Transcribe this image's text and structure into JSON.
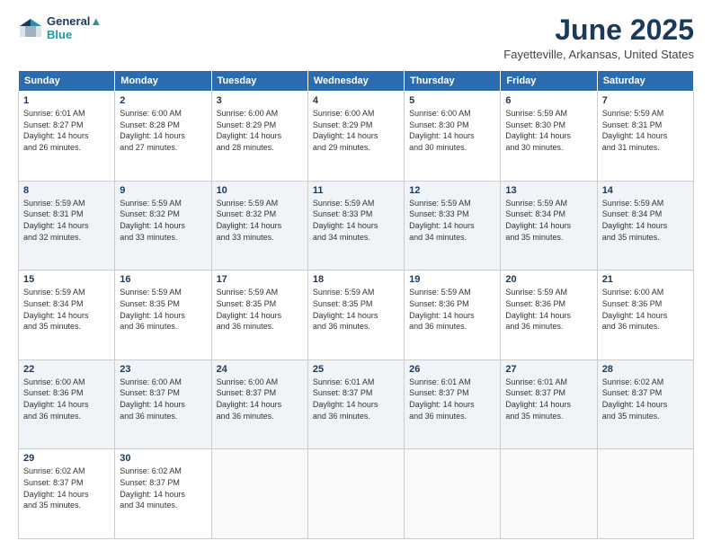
{
  "header": {
    "logo_line1": "General",
    "logo_line2": "Blue",
    "month_title": "June 2025",
    "location": "Fayetteville, Arkansas, United States"
  },
  "days_of_week": [
    "Sunday",
    "Monday",
    "Tuesday",
    "Wednesday",
    "Thursday",
    "Friday",
    "Saturday"
  ],
  "weeks": [
    [
      {
        "day": "1",
        "info": "Sunrise: 6:01 AM\nSunset: 8:27 PM\nDaylight: 14 hours\nand 26 minutes."
      },
      {
        "day": "2",
        "info": "Sunrise: 6:00 AM\nSunset: 8:28 PM\nDaylight: 14 hours\nand 27 minutes."
      },
      {
        "day": "3",
        "info": "Sunrise: 6:00 AM\nSunset: 8:29 PM\nDaylight: 14 hours\nand 28 minutes."
      },
      {
        "day": "4",
        "info": "Sunrise: 6:00 AM\nSunset: 8:29 PM\nDaylight: 14 hours\nand 29 minutes."
      },
      {
        "day": "5",
        "info": "Sunrise: 6:00 AM\nSunset: 8:30 PM\nDaylight: 14 hours\nand 30 minutes."
      },
      {
        "day": "6",
        "info": "Sunrise: 5:59 AM\nSunset: 8:30 PM\nDaylight: 14 hours\nand 30 minutes."
      },
      {
        "day": "7",
        "info": "Sunrise: 5:59 AM\nSunset: 8:31 PM\nDaylight: 14 hours\nand 31 minutes."
      }
    ],
    [
      {
        "day": "8",
        "info": "Sunrise: 5:59 AM\nSunset: 8:31 PM\nDaylight: 14 hours\nand 32 minutes."
      },
      {
        "day": "9",
        "info": "Sunrise: 5:59 AM\nSunset: 8:32 PM\nDaylight: 14 hours\nand 33 minutes."
      },
      {
        "day": "10",
        "info": "Sunrise: 5:59 AM\nSunset: 8:32 PM\nDaylight: 14 hours\nand 33 minutes."
      },
      {
        "day": "11",
        "info": "Sunrise: 5:59 AM\nSunset: 8:33 PM\nDaylight: 14 hours\nand 34 minutes."
      },
      {
        "day": "12",
        "info": "Sunrise: 5:59 AM\nSunset: 8:33 PM\nDaylight: 14 hours\nand 34 minutes."
      },
      {
        "day": "13",
        "info": "Sunrise: 5:59 AM\nSunset: 8:34 PM\nDaylight: 14 hours\nand 35 minutes."
      },
      {
        "day": "14",
        "info": "Sunrise: 5:59 AM\nSunset: 8:34 PM\nDaylight: 14 hours\nand 35 minutes."
      }
    ],
    [
      {
        "day": "15",
        "info": "Sunrise: 5:59 AM\nSunset: 8:34 PM\nDaylight: 14 hours\nand 35 minutes."
      },
      {
        "day": "16",
        "info": "Sunrise: 5:59 AM\nSunset: 8:35 PM\nDaylight: 14 hours\nand 36 minutes."
      },
      {
        "day": "17",
        "info": "Sunrise: 5:59 AM\nSunset: 8:35 PM\nDaylight: 14 hours\nand 36 minutes."
      },
      {
        "day": "18",
        "info": "Sunrise: 5:59 AM\nSunset: 8:35 PM\nDaylight: 14 hours\nand 36 minutes."
      },
      {
        "day": "19",
        "info": "Sunrise: 5:59 AM\nSunset: 8:36 PM\nDaylight: 14 hours\nand 36 minutes."
      },
      {
        "day": "20",
        "info": "Sunrise: 5:59 AM\nSunset: 8:36 PM\nDaylight: 14 hours\nand 36 minutes."
      },
      {
        "day": "21",
        "info": "Sunrise: 6:00 AM\nSunset: 8:36 PM\nDaylight: 14 hours\nand 36 minutes."
      }
    ],
    [
      {
        "day": "22",
        "info": "Sunrise: 6:00 AM\nSunset: 8:36 PM\nDaylight: 14 hours\nand 36 minutes."
      },
      {
        "day": "23",
        "info": "Sunrise: 6:00 AM\nSunset: 8:37 PM\nDaylight: 14 hours\nand 36 minutes."
      },
      {
        "day": "24",
        "info": "Sunrise: 6:00 AM\nSunset: 8:37 PM\nDaylight: 14 hours\nand 36 minutes."
      },
      {
        "day": "25",
        "info": "Sunrise: 6:01 AM\nSunset: 8:37 PM\nDaylight: 14 hours\nand 36 minutes."
      },
      {
        "day": "26",
        "info": "Sunrise: 6:01 AM\nSunset: 8:37 PM\nDaylight: 14 hours\nand 36 minutes."
      },
      {
        "day": "27",
        "info": "Sunrise: 6:01 AM\nSunset: 8:37 PM\nDaylight: 14 hours\nand 35 minutes."
      },
      {
        "day": "28",
        "info": "Sunrise: 6:02 AM\nSunset: 8:37 PM\nDaylight: 14 hours\nand 35 minutes."
      }
    ],
    [
      {
        "day": "29",
        "info": "Sunrise: 6:02 AM\nSunset: 8:37 PM\nDaylight: 14 hours\nand 35 minutes."
      },
      {
        "day": "30",
        "info": "Sunrise: 6:02 AM\nSunset: 8:37 PM\nDaylight: 14 hours\nand 34 minutes."
      },
      null,
      null,
      null,
      null,
      null
    ]
  ]
}
